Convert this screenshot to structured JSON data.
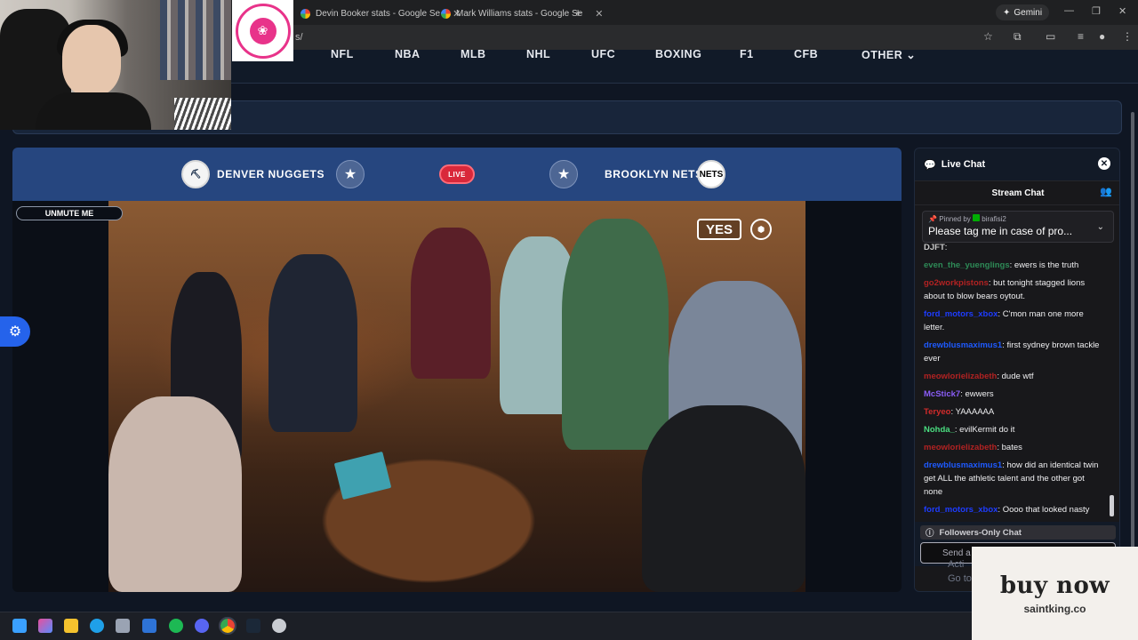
{
  "browser": {
    "tabs": [
      {
        "title": "Devin Booker stats - Google Se"
      },
      {
        "title": "Mark Williams stats - Google Se"
      }
    ],
    "new_tab": "+",
    "gemini_label": "Gemini",
    "address_partial": "s/"
  },
  "site_nav": {
    "items": [
      "NFL",
      "NBA",
      "MLB",
      "NHL",
      "UFC",
      "BOXING",
      "F1",
      "CFB",
      "OTHER"
    ]
  },
  "match": {
    "home_team": "DENVER NUGGETS",
    "away_team": "BROOKLYN NETS",
    "live_label": "LIVE",
    "home_logo": "nuggets-logo",
    "away_logo_text": "NETS"
  },
  "player": {
    "unmute_label": "UNMUTE ME",
    "network_bug": "YES"
  },
  "chat": {
    "title": "Live Chat",
    "stream_chat_label": "Stream Chat",
    "pinned": {
      "pinned_by_label": "Pinned by",
      "pinned_by_user": "birafisi2",
      "text": "Please tag me in case of pro..."
    },
    "messages": [
      {
        "user": "DJFT",
        "text": "",
        "color": "#c6c6c6"
      },
      {
        "user": "even_the_yuenglings",
        "text": "ewers is the truth",
        "color": "#2e8b57"
      },
      {
        "user": "go2workpistons",
        "text": "but tonight stagged lions about to blow bears oytout.",
        "color": "#b22222"
      },
      {
        "user": "ford_motors_xbox",
        "text": "C'mon man one more letter.",
        "color": "#1e3cff"
      },
      {
        "user": "drewblusmaximus1",
        "text": "first sydney brown tackle ever",
        "color": "#1e5aff"
      },
      {
        "user": "meowlorielizabeth",
        "text": "dude wtf",
        "color": "#b22222"
      },
      {
        "user": "McStick7",
        "text": "ewwers",
        "color": "#8a5cf6"
      },
      {
        "user": "Teryeo",
        "text": "YAAAAAA",
        "color": "#d22b2b"
      },
      {
        "user": "Nohda_",
        "text": "evilKermit do it",
        "color": "#4ade80"
      },
      {
        "user": "meowlorielizabeth",
        "text": "bates",
        "color": "#b22222"
      },
      {
        "user": "drewblusmaximus1",
        "text": "how did an identical twin get ALL the athletic talent and the other got none",
        "color": "#1e5aff"
      },
      {
        "user": "ford_motors_xbox",
        "text": "Oooo that looked nasty",
        "color": "#1e3cff"
      }
    ],
    "followers_only": "Followers-Only Chat",
    "input_placeholder": "Send a",
    "activate_line1": "Acti",
    "activate_line2": "Go to"
  },
  "overlays": {
    "buy_now": "buy now",
    "buy_now_site": "saintking.co"
  },
  "colors": {
    "match_bar": "#26467f",
    "live": "#d9283a",
    "settings_button": "#2563eb"
  }
}
